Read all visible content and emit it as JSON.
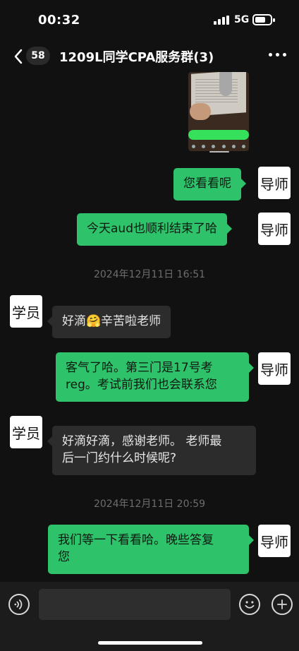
{
  "status_bar": {
    "time": "00:32",
    "network": "5G"
  },
  "header": {
    "back_badge": "58",
    "title": "1209L同学CPA服务群(3)"
  },
  "messages": [
    {
      "type": "media",
      "direction": "out",
      "sender": "导师"
    },
    {
      "type": "text",
      "direction": "out",
      "sender": "导师",
      "text": "您看看呢"
    },
    {
      "type": "text",
      "direction": "out",
      "sender": "导师",
      "text": "今天aud也顺利结束了哈"
    },
    {
      "type": "time",
      "text": "2024年12月11日 16:51"
    },
    {
      "type": "text",
      "direction": "in",
      "sender": "学员",
      "text": "好滴🤗辛苦啦老师"
    },
    {
      "type": "text",
      "direction": "out",
      "sender": "导师",
      "lines": [
        "客气了哈。第三门是17号考",
        "reg。考试前我们也会联系您"
      ]
    },
    {
      "type": "text",
      "direction": "in",
      "sender": "学员",
      "lines": [
        "好滴好滴，感谢老师。 老师最",
        "后一门约什么时候呢?"
      ]
    },
    {
      "type": "time",
      "text": "2024年12月11日 20:59"
    },
    {
      "type": "text",
      "direction": "out",
      "sender": "导师",
      "lines": [
        "我们等一下看看哈。晚些答复",
        "您"
      ]
    }
  ],
  "input": {
    "placeholder": ""
  },
  "colors": {
    "background": "#111111",
    "outgoing_bubble": "#2ec26a",
    "incoming_bubble": "#2c2c2c",
    "timestamp": "#6d6d6d"
  }
}
